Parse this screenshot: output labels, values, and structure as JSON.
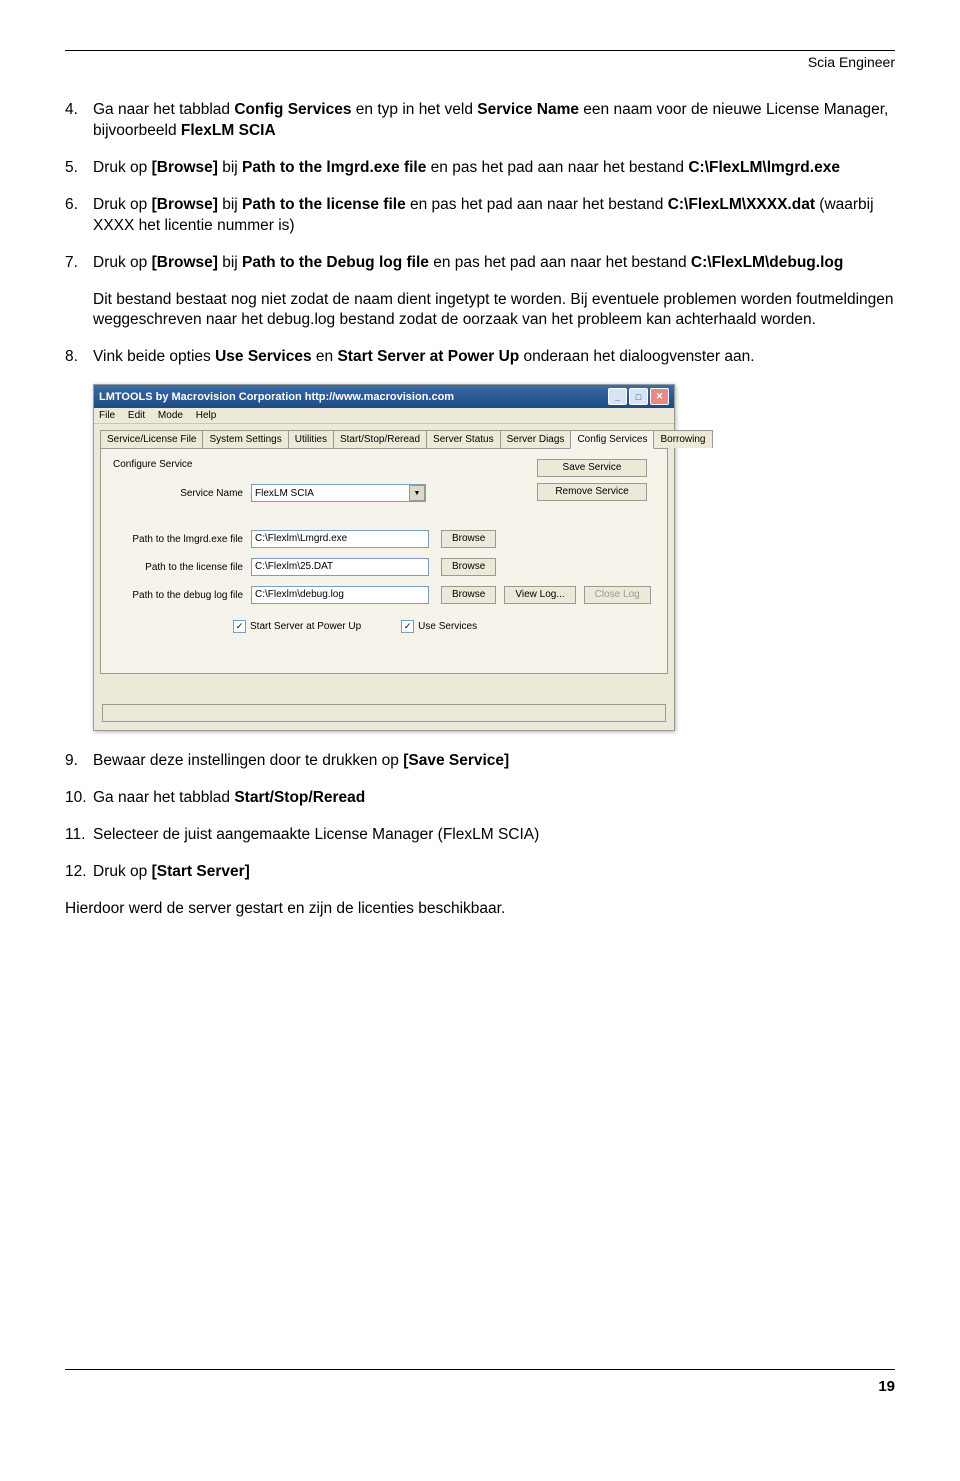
{
  "header": "Scia Engineer",
  "steps": {
    "s4": {
      "num": "4.",
      "text_before": "Ga naar het tabblad ",
      "bold1": "Config Services",
      "text_mid1": " en typ in het veld ",
      "bold2": "Service Name",
      "text_mid2": " een naam voor de nieuwe License Manager, bijvoorbeeld ",
      "bold3": "FlexLM SCIA"
    },
    "s5": {
      "num": "5.",
      "text_before": "Druk op ",
      "bold1": "[Browse]",
      "text_mid1": " bij ",
      "bold2": "Path to the lmgrd.exe file",
      "text_mid2": " en pas het pad aan naar het bestand ",
      "bold3": "C:\\FlexLM\\lmgrd.exe"
    },
    "s6": {
      "num": "6.",
      "text_before": "Druk op ",
      "bold1": "[Browse]",
      "text_mid1": " bij ",
      "bold2": "Path to the license file",
      "text_mid2": " en pas het pad aan naar het bestand ",
      "bold3": "C:\\FlexLM\\XXXX.dat",
      "text_after": " (waarbij XXXX het licentie nummer is)"
    },
    "s7": {
      "num": "7.",
      "text_before": "Druk op ",
      "bold1": "[Browse]",
      "text_mid1": " bij ",
      "bold2": "Path to the Debug log file",
      "text_mid2": " en pas het pad aan naar het bestand ",
      "bold3": "C:\\FlexLM\\debug.log"
    },
    "s7_sub": "Dit bestand bestaat nog niet zodat de naam dient ingetypt te worden. Bij eventuele problemen worden foutmeldingen weggeschreven naar het debug.log bestand zodat de oorzaak van het probleem kan achterhaald worden.",
    "s8": {
      "num": "8.",
      "text_before": "Vink beide opties ",
      "bold1": "Use Services",
      "text_mid1": " en ",
      "bold2": "Start Server at Power Up",
      "text_after": " onderaan het dialoogvenster aan."
    },
    "s9": {
      "num": "9.",
      "text_before": "Bewaar deze instellingen door te drukken op ",
      "bold1": "[Save Service]"
    },
    "s10": {
      "num": "10.",
      "text_before": "Ga naar het tabblad ",
      "bold1": "Start/Stop/Reread"
    },
    "s11": {
      "num": "11.",
      "text": "Selecteer de juist aangemaakte License Manager (FlexLM SCIA)"
    },
    "s12": {
      "num": "12.",
      "text_before": "Druk op ",
      "bold1": "[Start Server]"
    },
    "final": "Hierdoor werd de server gestart en zijn de licenties beschikbaar."
  },
  "dialog": {
    "title": "LMTOOLS by Macrovision Corporation http://www.macrovision.com",
    "menu": [
      "File",
      "Edit",
      "Mode",
      "Help"
    ],
    "tabs": [
      "Service/License File",
      "System Settings",
      "Utilities",
      "Start/Stop/Reread",
      "Server Status",
      "Server Diags",
      "Config Services",
      "Borrowing"
    ],
    "panel_title": "Configure Service",
    "labels": {
      "service_name": "Service Name",
      "lmgrd": "Path to the lmgrd.exe file",
      "license": "Path to the license file",
      "debug": "Path to the debug log file"
    },
    "values": {
      "service_name": "FlexLM SCIA",
      "lmgrd": "C:\\Flexlm\\Lmgrd.exe",
      "license": "C:\\Flexlm\\25.DAT",
      "debug": "C:\\Flexlm\\debug.log"
    },
    "buttons": {
      "browse": "Browse",
      "save": "Save Service",
      "remove": "Remove Service",
      "viewlog": "View Log...",
      "closelog": "Close Log"
    },
    "checks": {
      "start_powerup": "Start Server at Power Up",
      "use_services": "Use Services"
    }
  },
  "page_number": "19"
}
